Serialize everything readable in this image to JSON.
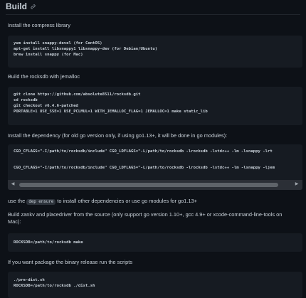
{
  "heading": {
    "title": "Build"
  },
  "sections": {
    "compress_intro": "Install the compress library",
    "compress_code": [
      "yum install snappy-devel (for CentOS)",
      "apt-get install libsnappy1 libsnappy-dev (for Debian/Ubuntu)",
      "brew install snappy (for Mac)"
    ],
    "rocksdb_intro": "Build the rocksdb with jemalloc",
    "rocksdb_code": [
      "git clone https://github.com/absolute8511/rocksdb.git",
      "cd rocksdb",
      "git checkout v6.4.6-patched",
      "PORTABLE=1 USE_SSE=1 USE_PCLMUL=1 WITH_JEMALLOC_FLAG=1 JEMALLOC=1 make static_lib"
    ],
    "dependency_intro": "Install the dependency (for old go version only, if using go1.13+, it will be done in go modules):",
    "dependency_code": [
      "CGO_CFLAGS=\"-I/path/to/rocksdb/include\" CGO_LDFLAGS=\"-L/path/to/rocksdb -lrocksdb -lstdc++ -lm -lsnappy -lrt",
      "CGO_CFLAGS=\"-I/path/to/rocksdb/include\" CGO_LDFLAGS=\"-L/path/to/rocksdb -lrocksdb -lstdc++ -lm -lsnappy -ljem"
    ],
    "dep_text_before": "use the",
    "dep_inline_code": "dep ensure",
    "dep_text_after": "to install other dependencies or use go modules for go1.13+",
    "zankv_intro": "Build zankv and placedriver from the source (only support go version 1.10+, gcc 4.9+ or xcode-command-line-tools on Mac):",
    "zankv_code": [
      "ROCKSDB=/path/to/rocksdb make"
    ],
    "package_intro": "If you want package the binary release run the scripts",
    "package_code": [
      "./pre-dist.sh",
      "ROCKSDB=/path/to/rocksdb ./dist.sh"
    ]
  },
  "scrollbar": {
    "left_arrow": "◀",
    "right_arrow": "▶"
  },
  "icons": {
    "anchor": "link-icon"
  }
}
